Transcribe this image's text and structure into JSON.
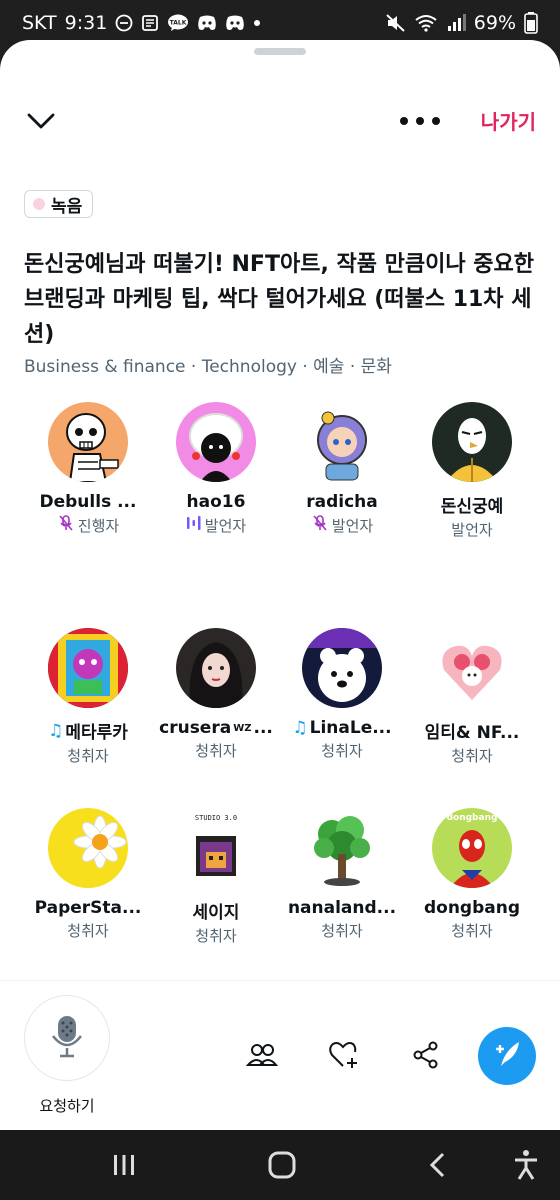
{
  "status_bar": {
    "carrier": "SKT",
    "time": "9:31",
    "battery": "69%",
    "left_icons": [
      "dnd-icon",
      "news-icon",
      "talk-icon",
      "discord-icon",
      "discord-icon",
      "dot-icon"
    ],
    "right_icons": [
      "mute-icon",
      "wifi-icon",
      "signal-icon",
      "battery-icon"
    ],
    "talk_label": "TALK"
  },
  "header": {
    "leave_label": "나가기",
    "leave_color": "#e0245e"
  },
  "recording_badge": "녹음",
  "space": {
    "title": "돈신궁예님과 떠불기! NFT아트, 작품 만큼이나 중요한 브랜딩과 마케팅 팁, 싹다 털어가세요 (떠불스 11차 세션)",
    "topics": "Business & finance · Technology · 예술 · 문화"
  },
  "participants": [
    {
      "name": "Debulls ...",
      "role": "진행자",
      "role_icon": "mic-muted-icon",
      "note": false
    },
    {
      "name": "hao16",
      "role": "발언자",
      "role_icon": "speaking-bars-icon",
      "note": false
    },
    {
      "name": "radicha",
      "role": "발언자",
      "role_icon": "mic-muted-icon",
      "note": false
    },
    {
      "name": "돈신궁예",
      "role": "발언자",
      "role_icon": "",
      "note": false
    },
    {
      "name": "메타루카",
      "role": "청취자",
      "role_icon": "",
      "note": true
    },
    {
      "name": "crusera",
      "name_sup": "WZ",
      "name_tail": "...",
      "role": "청취자",
      "role_icon": "",
      "note": false
    },
    {
      "name": "LinaLe...",
      "role": "청취자",
      "role_icon": "",
      "note": true
    },
    {
      "name": "임티& NF...",
      "role": "청취자",
      "role_icon": "",
      "note": false
    },
    {
      "name": "PaperSta...",
      "role": "청취자",
      "role_icon": "",
      "note": false
    },
    {
      "name": "세이지",
      "role": "청취자",
      "role_icon": "",
      "note": false
    },
    {
      "name": "nanaland...",
      "role": "청취자",
      "role_icon": "",
      "note": false
    },
    {
      "name": "dongbang",
      "role": "청취자",
      "role_icon": "",
      "note": false
    }
  ],
  "avatar_text": {
    "studio": "STUDIO 3.0",
    "dongbang": "dongbang"
  },
  "action_bar": {
    "request_label": "요청하기",
    "accent": "#1d9bf0"
  },
  "navbar": {
    "icons": [
      "recent-apps-icon",
      "home-icon",
      "back-icon",
      "accessibility-icon"
    ]
  }
}
